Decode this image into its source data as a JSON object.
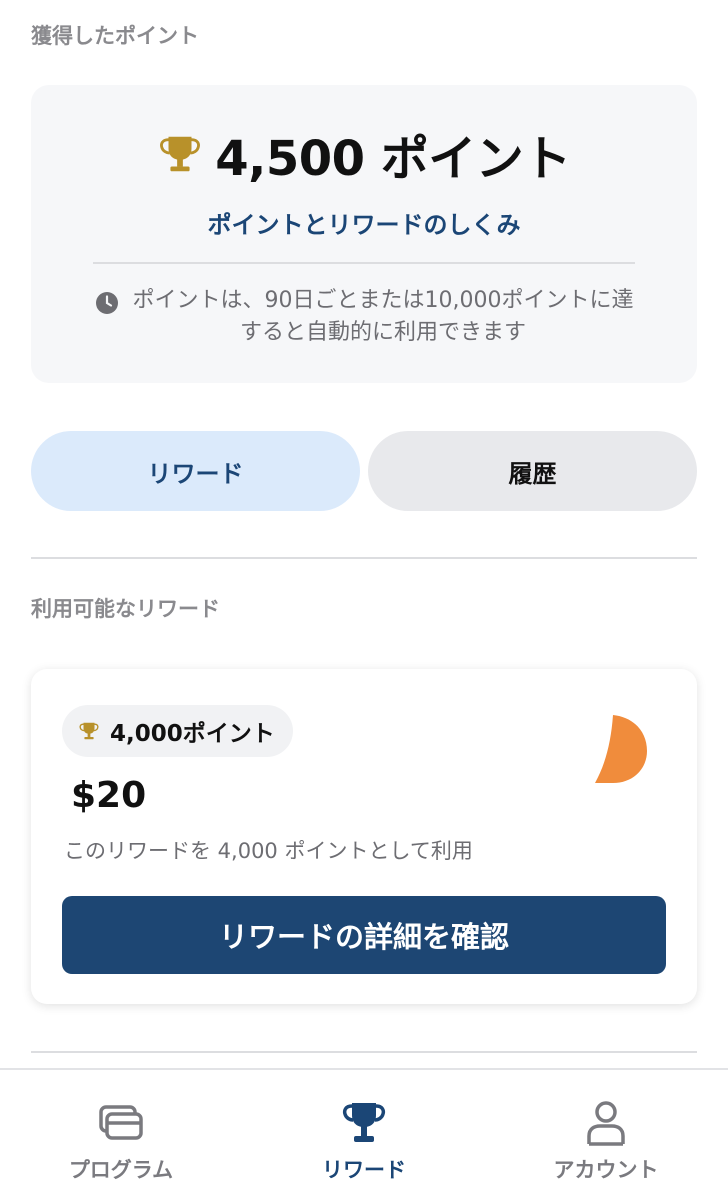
{
  "earned_section": {
    "label": "獲得したポイント",
    "points_text": "4,500 ポイント",
    "how_it_works_link": "ポイントとリワードのしくみ",
    "notice_line1": "ポイントは、90日ごとまたは10,000ポイントに達",
    "notice_line2": "すると自動的に利用できます"
  },
  "segment_control": {
    "rewards_label": "リワード",
    "history_label": "履歴",
    "selected": "rewards"
  },
  "available_section": {
    "label": "利用可能なリワード",
    "reward": {
      "badge_text": "4,000ポイント",
      "amount": "$20",
      "description": "このリワードを 4,000 ポイントとして利用",
      "button_label": "リワードの詳細を確認"
    }
  },
  "tab_bar": {
    "tabs": [
      {
        "label": "プログラム",
        "icon": "cards-icon",
        "active": false
      },
      {
        "label": "リワード",
        "icon": "trophy-icon",
        "active": true
      },
      {
        "label": "アカウント",
        "icon": "person-icon",
        "active": false
      }
    ]
  },
  "colors": {
    "accent": "#1b4676",
    "button": "#1d4673",
    "trophy_gold": "#b8912a",
    "segment_selected": "#dbeafb",
    "segment_unselected": "#e8e9ec",
    "reward_logo": "#f08c3c"
  }
}
